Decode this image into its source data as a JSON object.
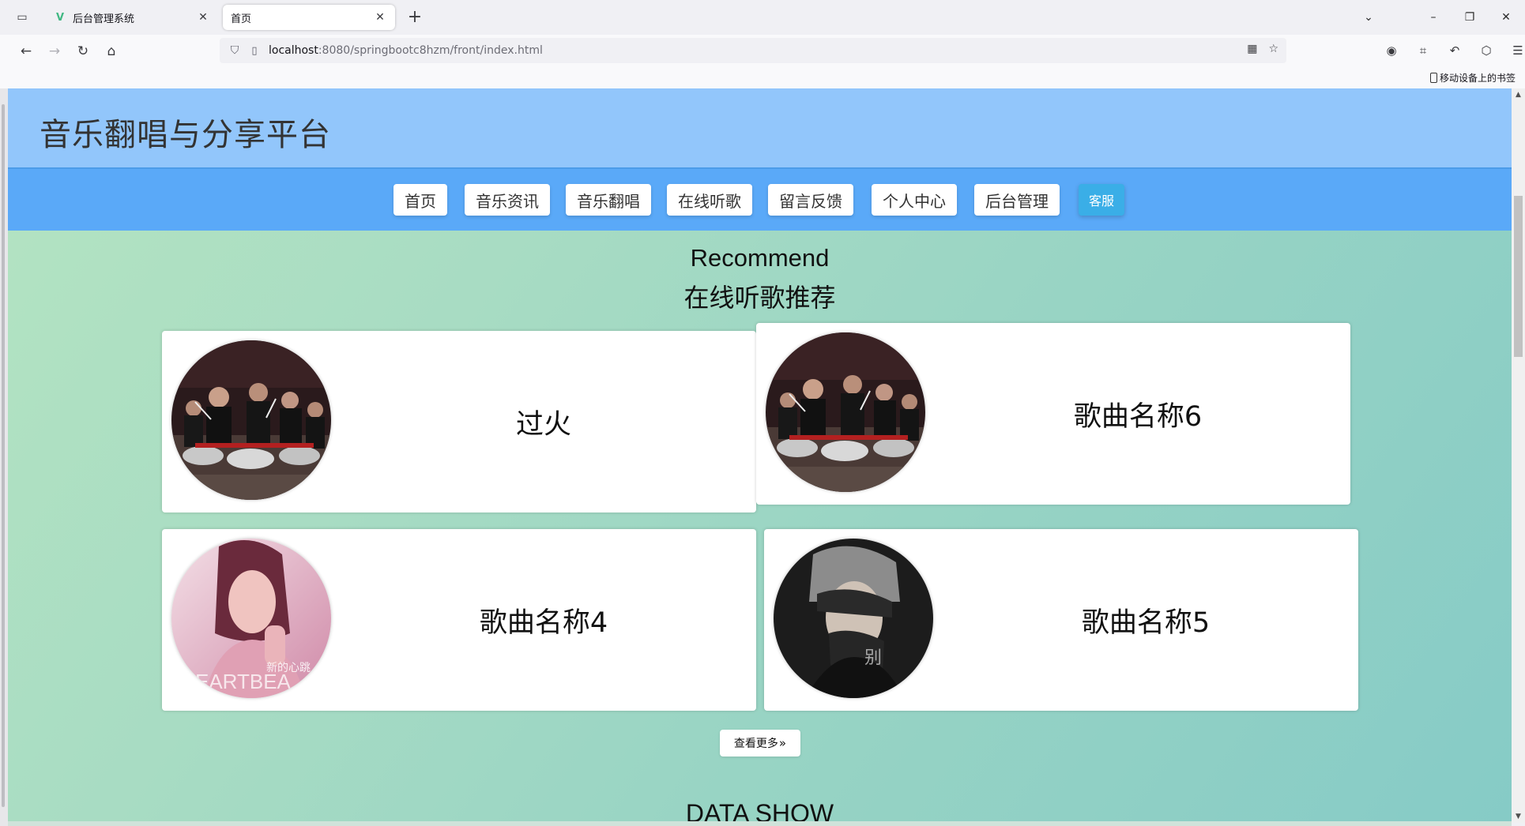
{
  "browser": {
    "tabs": [
      {
        "title": "后台管理系统",
        "active": false,
        "favicon": "vue-icon"
      },
      {
        "title": "首页",
        "active": true,
        "favicon": "none"
      }
    ],
    "url_host": "localhost",
    "url_path": ":8080/springbootc8hzm/front/index.html",
    "bookmark_label": "移动设备上的书签"
  },
  "site": {
    "title": "音乐翻唱与分享平台",
    "menu": [
      {
        "label": "首页"
      },
      {
        "label": "音乐资讯"
      },
      {
        "label": "音乐翻唱"
      },
      {
        "label": "在线听歌"
      },
      {
        "label": "留言反馈"
      },
      {
        "label": "个人中心"
      },
      {
        "label": "后台管理"
      }
    ],
    "service_label": "客服"
  },
  "recommend": {
    "title_en": "Recommend",
    "title_cn": "在线听歌推荐",
    "songs": [
      {
        "name": "过火",
        "cover": "drum-ensemble-photo"
      },
      {
        "name": "歌曲名称6",
        "cover": "drum-ensemble-photo"
      },
      {
        "name": "歌曲名称4",
        "cover": "female-singer-heartbeat-album"
      },
      {
        "name": "歌曲名称5",
        "cover": "male-singer-bie-album"
      }
    ],
    "more_label": "查看更多",
    "more_icon": "double-chevron-right-icon"
  },
  "data_show_title": "DATA SHOW",
  "colors": {
    "header_bg": "#92c6fb",
    "nav_bg": "#5aa9f8",
    "service_btn": "#3aaee7",
    "page_bg_start": "#b4e4c2",
    "page_bg_end": "#86cbc6"
  }
}
